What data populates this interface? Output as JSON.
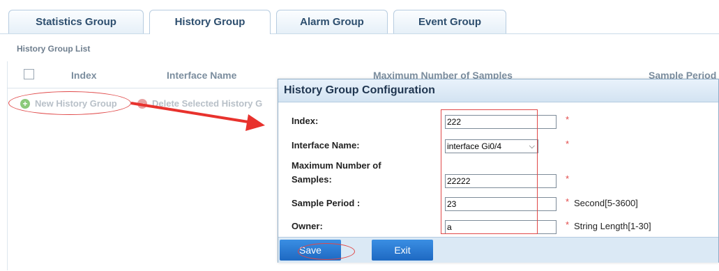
{
  "tabs": [
    {
      "label": "Statistics Group"
    },
    {
      "label": "History Group"
    },
    {
      "label": "Alarm Group"
    },
    {
      "label": "Event Group"
    }
  ],
  "list": {
    "title": "History Group List",
    "columns": [
      "Index",
      "Interface Name",
      "Maximum Number of Samples",
      "Sample Period"
    ],
    "add_label": "New History Group",
    "delete_label": "Delete Selected History G"
  },
  "dialog": {
    "title": "History Group Configuration",
    "fields": {
      "index": {
        "label": "Index:",
        "value": "222",
        "required": "*"
      },
      "interface": {
        "label": "Interface Name:",
        "value": "interface Gi0/4",
        "required": "*"
      },
      "max_samples": {
        "label_line1": "Maximum Number of",
        "label_line2": "Samples:",
        "value": "22222",
        "required": "*"
      },
      "sample_period": {
        "label": "Sample Period :",
        "value": "23",
        "required": "*",
        "hint": "Second[5-3600]"
      },
      "owner": {
        "label": "Owner:",
        "value": "a",
        "required": "*",
        "hint": "String Length[1-30]"
      }
    },
    "buttons": {
      "save": "Save",
      "exit": "Exit"
    }
  },
  "colors": {
    "annotation": "#e04848",
    "button": "#2a7bd3",
    "tab_text": "#2d4e6e"
  }
}
